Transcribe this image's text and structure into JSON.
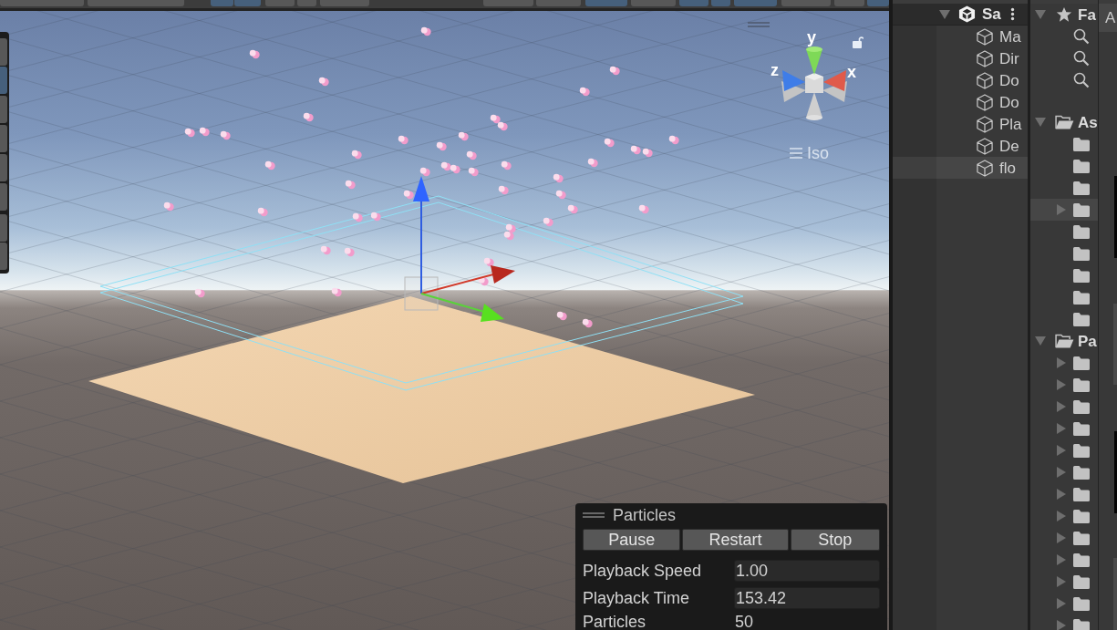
{
  "toolbar": {
    "buttons": [
      {
        "selected": false
      },
      {
        "selected": false
      },
      {
        "selected": true
      },
      {
        "selected": true
      },
      {
        "selected": false
      },
      {
        "selected": false
      },
      {
        "selected": false
      },
      {
        "selected": false
      },
      {
        "selected": false
      },
      {
        "selected": true
      },
      {
        "selected": false
      },
      {
        "selected": true
      },
      {
        "selected": true
      },
      {
        "selected": true
      },
      {
        "selected": false
      },
      {
        "selected": false
      },
      {
        "selected": true
      }
    ]
  },
  "scene": {
    "tools": [
      {
        "selected": false
      },
      {
        "selected": true
      },
      {
        "selected": false
      },
      {
        "selected": false
      },
      {
        "selected": false
      },
      {
        "selected": false
      },
      {
        "selected": false
      },
      {
        "selected": false
      }
    ],
    "orientation_gizmo": {
      "axes": [
        {
          "kind": "y",
          "label": "y"
        },
        {
          "kind": "z",
          "label": "z"
        },
        {
          "kind": "x",
          "label": "x"
        }
      ]
    },
    "projection": "Iso",
    "particle_controls": {
      "title": "Particles",
      "buttons": [
        "Pause",
        "Restart",
        "Stop"
      ],
      "rows": [
        {
          "kind": "field",
          "label": "Playback Speed",
          "value": "1.00"
        },
        {
          "kind": "field",
          "label": "Playback Time",
          "value": "153.42"
        },
        {
          "kind": "readout",
          "label": "Particles",
          "value": "50"
        }
      ]
    }
  },
  "hierarchy": {
    "scene": {
      "name": "Sa",
      "expanded": true
    },
    "items": [
      {
        "name": "Ma",
        "selected": false
      },
      {
        "name": "Dir",
        "selected": false
      },
      {
        "name": "Do",
        "selected": false
      },
      {
        "name": "Do",
        "selected": false
      },
      {
        "name": "Pla",
        "selected": false
      },
      {
        "name": "De",
        "selected": false
      },
      {
        "name": "flo",
        "selected": true
      }
    ]
  },
  "project": {
    "favorites": {
      "label": "Fa",
      "expanded": true,
      "items": [
        {
          "kind": "search"
        },
        {
          "kind": "search"
        },
        {
          "kind": "search"
        }
      ]
    },
    "assets": {
      "label": "As",
      "expanded": true,
      "children": [
        {
          "expandable": false,
          "selected": false
        },
        {
          "expandable": false,
          "selected": false
        },
        {
          "expandable": false,
          "selected": false
        },
        {
          "expandable": true,
          "selected": true
        },
        {
          "expandable": false,
          "selected": false
        },
        {
          "expandable": false,
          "selected": false
        },
        {
          "expandable": false,
          "selected": false
        },
        {
          "expandable": false,
          "selected": false
        },
        {
          "expandable": false,
          "selected": false
        }
      ]
    },
    "packages": {
      "label": "Pa",
      "expanded": true,
      "children": [
        {
          "expandable": true,
          "selected": false
        },
        {
          "expandable": true,
          "selected": false
        },
        {
          "expandable": true,
          "selected": false
        },
        {
          "expandable": true,
          "selected": false
        },
        {
          "expandable": true,
          "selected": false
        },
        {
          "expandable": true,
          "selected": false
        },
        {
          "expandable": true,
          "selected": false
        },
        {
          "expandable": true,
          "selected": false
        },
        {
          "expandable": true,
          "selected": false
        },
        {
          "expandable": true,
          "selected": false
        },
        {
          "expandable": true,
          "selected": false
        },
        {
          "expandable": true,
          "selected": false
        },
        {
          "expandable": true,
          "selected": false
        }
      ]
    }
  },
  "asset_view": {
    "tab": "A"
  }
}
